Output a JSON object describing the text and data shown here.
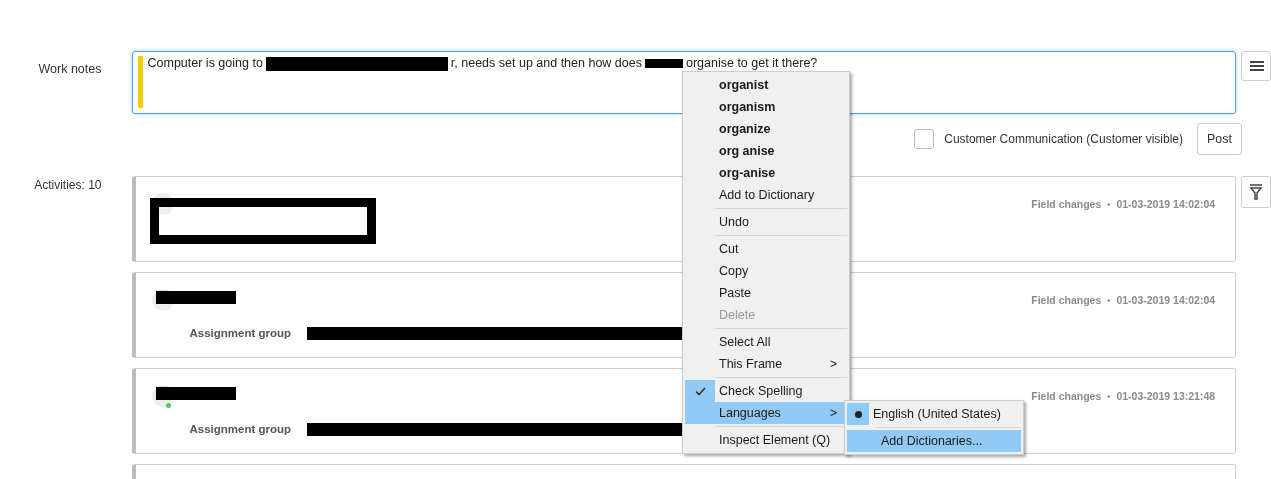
{
  "work_notes": {
    "label": "Work notes",
    "text_parts": [
      "Computer is going to",
      "r, needs set up and then how does",
      "organise to get it there?"
    ]
  },
  "post_bar": {
    "checkbox": {
      "label": "Customer Communication (Customer visible)",
      "checked": false
    },
    "post_button": "Post"
  },
  "activities": {
    "label": "Activities: 10",
    "cards": [
      {
        "kind": "boxed",
        "meta_type": "Field changes",
        "meta_separator": "•",
        "timestamp": "01-03-2019 14:02:04"
      },
      {
        "kind": "field",
        "online": false,
        "field_label": "Assignment group",
        "meta_type": "Field changes",
        "meta_separator": "•",
        "timestamp": "01-03-2019 14:02:04"
      },
      {
        "kind": "field",
        "online": true,
        "field_label": "Assignment group",
        "meta_type": "Field changes",
        "meta_separator": "•",
        "timestamp": "01-03-2019 13:21:48"
      },
      {
        "kind": "empty"
      }
    ]
  },
  "context_menu": {
    "groups": [
      [
        {
          "kind": "suggestion",
          "label": "organist"
        },
        {
          "kind": "suggestion",
          "label": "organism"
        },
        {
          "kind": "suggestion",
          "label": "organize"
        },
        {
          "kind": "suggestion",
          "label": "org anise"
        },
        {
          "kind": "suggestion",
          "label": "org-anise"
        },
        {
          "kind": "command",
          "label": "Add to Dictionary",
          "disabled": false,
          "selected": false
        }
      ],
      [
        {
          "kind": "command",
          "label": "Undo",
          "disabled": false,
          "selected": false
        }
      ],
      [
        {
          "kind": "command",
          "label": "Cut",
          "disabled": false,
          "selected": false
        },
        {
          "kind": "command",
          "label": "Copy",
          "disabled": false,
          "selected": false
        },
        {
          "kind": "command",
          "label": "Paste",
          "disabled": false,
          "selected": false
        },
        {
          "kind": "command",
          "label": "Delete",
          "disabled": true,
          "selected": false
        }
      ],
      [
        {
          "kind": "command",
          "label": "Select All",
          "disabled": false,
          "selected": false
        },
        {
          "kind": "submenu",
          "label": "This Frame",
          "disabled": false,
          "selected": false,
          "arrow": ">"
        }
      ],
      [
        {
          "kind": "check",
          "label": "Check Spelling",
          "checked": true,
          "disabled": false,
          "selected": false
        },
        {
          "kind": "submenu",
          "label": "Languages",
          "disabled": false,
          "selected": true,
          "arrow": ">"
        }
      ],
      [
        {
          "kind": "command",
          "label": "Inspect Element (Q)",
          "disabled": false,
          "selected": false
        }
      ]
    ],
    "submenu": {
      "groups": [
        [
          {
            "kind": "radio",
            "label": "English (United States)",
            "checked": true,
            "selected": false
          }
        ],
        [
          {
            "kind": "command",
            "label": "Add Dictionaries...",
            "selected": true
          }
        ]
      ]
    }
  }
}
